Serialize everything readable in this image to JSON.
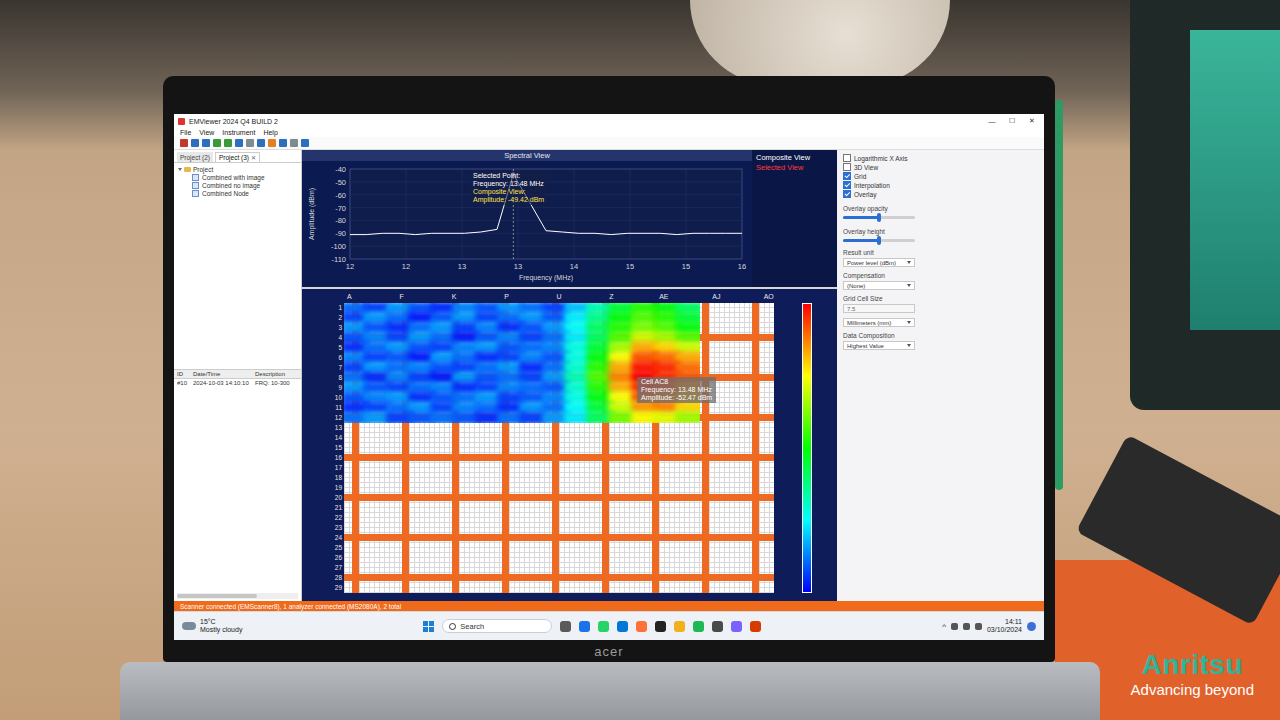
{
  "window": {
    "title": "EMViewer 2024 Q4 BUILD 2",
    "controls": [
      "—",
      "☐",
      "✕"
    ]
  },
  "menu": [
    "File",
    "View",
    "Instrument",
    "Help"
  ],
  "project_panel": {
    "close_glyph": "✕",
    "tabs": [
      {
        "label": "Project (2)",
        "selected": false,
        "closable": false
      },
      {
        "label": "Project (3)",
        "selected": true,
        "closable": true
      }
    ],
    "tree": {
      "root": "Project",
      "expanded": true,
      "items": [
        {
          "label": "Combined with image",
          "selected": false
        },
        {
          "label": "Combined no image",
          "selected": false
        },
        {
          "label": "Combined Node",
          "selected": false
        }
      ]
    }
  },
  "measurements": {
    "columns": [
      "ID",
      "Date/Time",
      "Description"
    ],
    "rows": [
      {
        "cells": [
          "#10",
          "2024-10-03 14:10:10",
          "FRQ: 10-300"
        ],
        "selected": false
      }
    ]
  },
  "spectral": {
    "title": "Spectral View",
    "y_label": "Amplitude (dBm)",
    "x_label": "Frequency (MHz)",
    "y_ticks": [
      "-40",
      "-50",
      "-60",
      "-70",
      "-80",
      "-90",
      "-100",
      "-110"
    ],
    "x_ticks": [
      "12",
      "12",
      "13",
      "13",
      "14",
      "15",
      "15",
      "16"
    ],
    "series": [
      {
        "name": "Composite View",
        "color": "#ffffff",
        "values": [
          -91,
          -91,
          -90,
          -90,
          -91,
          -90,
          -90,
          -90,
          -89,
          -87,
          -44,
          -66,
          -88,
          -89,
          -90,
          -90,
          -91,
          -90,
          -90,
          -90,
          -91,
          -90,
          -90,
          -90,
          -90
        ]
      }
    ],
    "selected_index": 10,
    "tooltip": [
      {
        "text": "Selected Point:",
        "color": "#ffffff"
      },
      {
        "text": "Frequency: 13.48 MHz",
        "color": "#ffffff"
      },
      {
        "text": "Composite View:",
        "color": "#ffe44d"
      },
      {
        "text": "Amplitude: -49.42 dBm",
        "color": "#ffe44d"
      }
    ],
    "legend": [
      {
        "label": "Composite View",
        "color": "#ffffff"
      },
      {
        "label": "Selected View",
        "color": "#ff3b3b"
      }
    ]
  },
  "heatmap": {
    "column_labels": [
      "A",
      "F",
      "K",
      "P",
      "U",
      "Z",
      "AE",
      "AJ",
      "AO"
    ],
    "row_labels": [
      "1",
      "2",
      "3",
      "4",
      "5",
      "6",
      "7",
      "8",
      "9",
      "10",
      "11",
      "12",
      "13",
      "14",
      "15",
      "16",
      "17",
      "18",
      "19",
      "20",
      "21",
      "22",
      "23",
      "24",
      "25",
      "26",
      "27",
      "28",
      "29"
    ],
    "values": [
      [
        -92,
        -94,
        -90,
        -93,
        -95,
        -91,
        -93,
        -90,
        -92,
        -94,
        -88,
        -82,
        -76,
        -72,
        -74,
        -78
      ],
      [
        -94,
        -90,
        -92,
        -96,
        -93,
        -90,
        -94,
        -92,
        -90,
        -93,
        -86,
        -80,
        -74,
        -70,
        -72,
        -76
      ],
      [
        -90,
        -93,
        -95,
        -92,
        -90,
        -94,
        -91,
        -95,
        -93,
        -90,
        -85,
        -78,
        -72,
        -68,
        -70,
        -74
      ],
      [
        -93,
        -91,
        -94,
        -90,
        -92,
        -96,
        -93,
        -91,
        -94,
        -92,
        -86,
        -78,
        -70,
        -64,
        -66,
        -70
      ],
      [
        -95,
        -92,
        -90,
        -93,
        -94,
        -91,
        -90,
        -93,
        -92,
        -91,
        -84,
        -76,
        -66,
        -58,
        -60,
        -64
      ],
      [
        -91,
        -94,
        -93,
        -96,
        -90,
        -92,
        -95,
        -94,
        -91,
        -93,
        -84,
        -74,
        -62,
        -54,
        -55,
        -58
      ],
      [
        -94,
        -90,
        -92,
        -91,
        -93,
        -94,
        -92,
        -90,
        -95,
        -92,
        -83,
        -72,
        -58,
        -51,
        -52,
        -55
      ],
      [
        -92,
        -95,
        -91,
        -94,
        -96,
        -90,
        -93,
        -92,
        -94,
        -90,
        -82,
        -70,
        -56,
        -50,
        -52,
        -54
      ],
      [
        -90,
        -93,
        -94,
        -92,
        -91,
        -95,
        -94,
        -91,
        -92,
        -93,
        -83,
        -72,
        -58,
        -52,
        -53,
        -56
      ],
      [
        -93,
        -91,
        -90,
        -95,
        -93,
        -92,
        -90,
        -94,
        -93,
        -91,
        -84,
        -74,
        -62,
        -54,
        -55,
        -58
      ],
      [
        -95,
        -94,
        -92,
        -90,
        -94,
        -91,
        -92,
        -95,
        -90,
        -92,
        -85,
        -76,
        -64,
        -57,
        -56,
        -60
      ],
      [
        -92,
        -90,
        -94,
        -93,
        -92,
        -93,
        -95,
        -92,
        -94,
        -90,
        -86,
        -78,
        -68,
        -62,
        -63,
        -66
      ]
    ],
    "tooltip": [
      "Cell AC8",
      "Frequency: 13.48 MHz",
      "Amplitude: -52.47 dBm"
    ]
  },
  "options": {
    "checkboxes": [
      {
        "label": "Logarithmic X Axis",
        "checked": false
      },
      {
        "label": "3D View",
        "checked": false
      },
      {
        "label": "Grid",
        "checked": true
      },
      {
        "label": "Interpolation",
        "checked": true
      },
      {
        "label": "Overlay",
        "checked": true
      }
    ],
    "sliders": [
      {
        "label": "Overlay opacity",
        "level": 0.5
      },
      {
        "label": "Overlay height",
        "level": 0.5
      }
    ],
    "fields": [
      {
        "label": "Result unit",
        "value": "Power level (dBm)",
        "kind": "select"
      },
      {
        "label": "Compensation",
        "value": "(None)",
        "kind": "select"
      },
      {
        "label": "Grid Cell Size",
        "value": "7.5",
        "kind": "input"
      },
      {
        "value": "Millimeters (mm)",
        "kind": "select"
      },
      {
        "label": "Data Composition",
        "value": "Highest Value",
        "kind": "select"
      }
    ]
  },
  "status_bar": "Scanner connected (EMScanner8), 1 analyzer connected (MS2080A), 2 total",
  "taskbar": {
    "weather": {
      "temp": "15°C",
      "text": "Mostly cloudy"
    },
    "search": "Search",
    "tray_arrow": "^",
    "time": "14:11",
    "date": "03/10/2024"
  },
  "laptop_brand": "acer",
  "watermark": {
    "brand": "Anritsu",
    "tagline": "Advancing beyond"
  }
}
